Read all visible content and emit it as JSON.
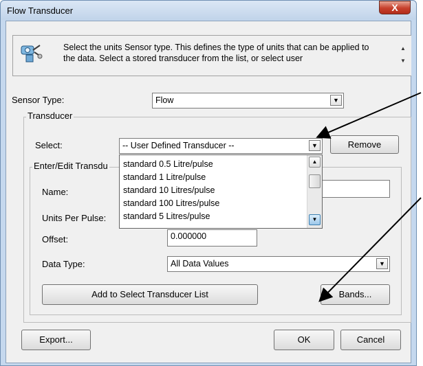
{
  "window": {
    "title": "Flow Transducer",
    "close_label": "X"
  },
  "description": {
    "text": "Select the units Sensor type. This defines the type of units that can be applied to the data. Select a stored transducer from the list, or select user"
  },
  "sensor_type": {
    "label": "Sensor Type:",
    "value": "Flow"
  },
  "transducer_group": {
    "title": "Transducer",
    "select_label": "Select:",
    "select_value": "-- User Defined Transducer --",
    "remove_label": "Remove",
    "dropdown_options": [
      "standard 0.5 Litre/pulse",
      "standard 1 Litre/pulse",
      "standard 10 Litres/pulse",
      "standard 100 Litres/pulse",
      "standard 5 Litres/pulse"
    ]
  },
  "edit_group": {
    "title": "Enter/Edit Transdu",
    "name_label": "Name:",
    "name_value": "",
    "units_label": "Units Per Pulse:",
    "offset_label": "Offset:",
    "offset_value": "0.000000",
    "data_type_label": "Data Type:",
    "data_type_value": "All Data Values",
    "add_button": "Add to Select Transducer List",
    "bands_button": "Bands..."
  },
  "footer": {
    "export": "Export...",
    "ok": "OK",
    "cancel": "Cancel"
  }
}
